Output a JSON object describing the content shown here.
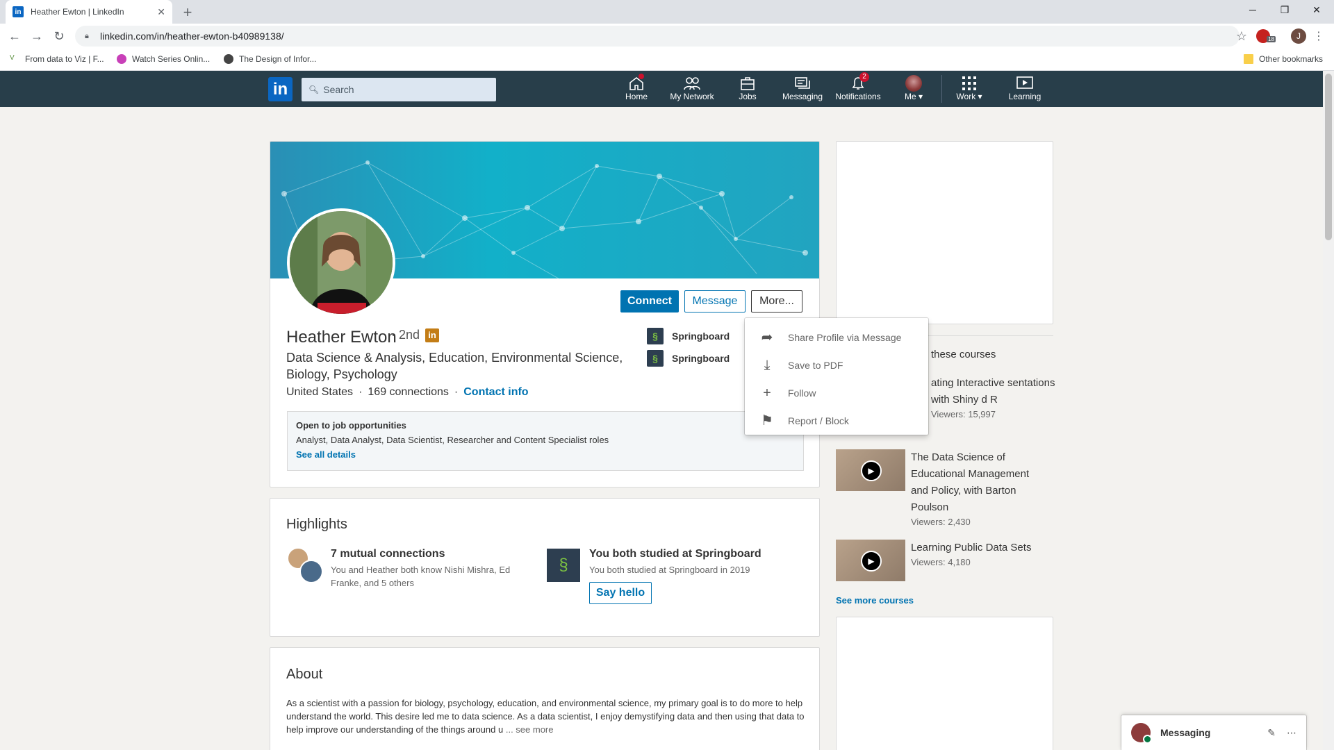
{
  "browser": {
    "tab_title": "Heather Ewton | LinkedIn",
    "tab_favicon": "in",
    "url": "linkedin.com/in/heather-ewton-b40989138/",
    "profile_initial": "J",
    "extension_badge": "18",
    "bookmarks": [
      {
        "label": "From data to Viz | F..."
      },
      {
        "label": "Watch Series Onlin..."
      },
      {
        "label": "The Design of Infor..."
      }
    ],
    "other_bookmarks": "Other bookmarks"
  },
  "header": {
    "logo": "in",
    "search_placeholder": "Search",
    "nav": [
      {
        "label": "Home",
        "badge": ""
      },
      {
        "label": "My Network",
        "badge": ""
      },
      {
        "label": "Jobs",
        "badge": ""
      },
      {
        "label": "Messaging",
        "badge": ""
      },
      {
        "label": "Notifications",
        "badge": "2"
      },
      {
        "label": "Me",
        "badge": ""
      },
      {
        "label": "Work",
        "badge": ""
      },
      {
        "label": "Learning",
        "badge": ""
      }
    ]
  },
  "profile": {
    "name": "Heather Ewton",
    "degree": "· 2nd",
    "degree_badge": "in",
    "headline": "Data Science & Analysis, Education, Environmental Science, Biology, Psychology",
    "location": "United States",
    "sep1": "·",
    "connections": "169 connections",
    "sep2": "·",
    "contact_info": "Contact info",
    "connect_label": "Connect",
    "message_label": "Message",
    "more_label": "More...",
    "education": [
      {
        "name": "Springboard"
      },
      {
        "name": "Springboard"
      }
    ],
    "jobs": {
      "title": "Open to job opportunities",
      "roles": "Analyst, Data Analyst, Data Scientist, Researcher and Content Specialist roles",
      "link": "See all details"
    }
  },
  "more_menu": [
    {
      "label": "Share Profile via Message",
      "icon": "share-icon"
    },
    {
      "label": "Save to PDF",
      "icon": "download-icon"
    },
    {
      "label": "Follow",
      "icon": "plus-icon"
    },
    {
      "label": "Report / Block",
      "icon": "flag-icon"
    }
  ],
  "highlights": {
    "title": "Highlights",
    "mutual_title": "7 mutual connections",
    "mutual_sub": "You and Heather both know Nishi Mishra, Ed Franke, and 5 others",
    "school_title": "You both studied at Springboard",
    "school_sub": "You both studied at Springboard in 2019",
    "say_hello": "Say hello"
  },
  "about": {
    "title": "About",
    "text": "As a scientist with a passion for biology, psychology, education, and environmental science, my primary goal is to do more to help understand the world. This desire led me to data science. As a data scientist, I enjoy demystifying data and then using that data to help improve our understanding of the things around u",
    "see_more": "... see more"
  },
  "courses": {
    "header": "these courses",
    "items": [
      {
        "title": "ating Interactive sentations with Shiny d R",
        "viewers": "Viewers: 15,997"
      },
      {
        "title": "The Data Science of Educational Management and Policy, with Barton Poulson",
        "viewers": "Viewers: 2,430"
      },
      {
        "title": "Learning Public Data Sets",
        "viewers": "Viewers: 4,180"
      }
    ],
    "see_more": "See more courses"
  },
  "messaging": {
    "label": "Messaging"
  }
}
